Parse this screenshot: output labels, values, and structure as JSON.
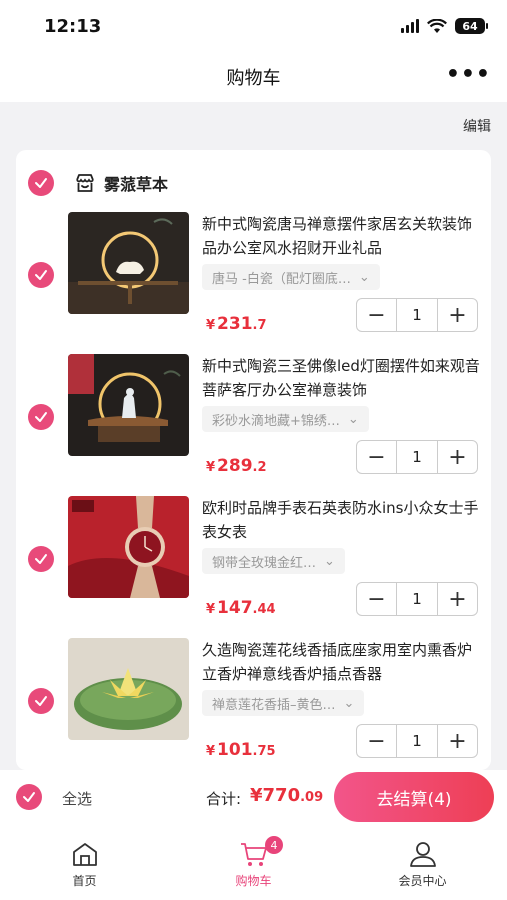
{
  "status_bar": {
    "time": "12:13",
    "battery": "64"
  },
  "header": {
    "title": "购物车",
    "more": "•••"
  },
  "edit_label": "编辑",
  "shop": {
    "name": "雾蒎草本",
    "checked": true
  },
  "items": [
    {
      "title": "新中式陶瓷唐马禅意摆件家居玄关软装饰品办公室风水招财开业礼品",
      "spec": "唐马 -白瓷（配灯圈底…",
      "price_int": "231",
      "price_dec": ".7",
      "quantity": "1",
      "checked": true
    },
    {
      "title": "新中式陶瓷三圣佛像led灯圈摆件如来观音菩萨客厅办公室禅意装饰",
      "spec": "彩砂水滴地藏+锦绣…",
      "price_int": "289",
      "price_dec": ".2",
      "quantity": "1",
      "checked": true
    },
    {
      "title": "欧利时品牌手表石英表防水ins小众女士手表女表",
      "spec": "钢带全玫瑰金红…",
      "price_int": "147",
      "price_dec": ".44",
      "quantity": "1",
      "checked": true
    },
    {
      "title": "久造陶瓷莲花线香插底座家用室内熏香炉立香炉禅意线香炉插点香器",
      "spec": "禅意莲花香插–黄色…",
      "price_int": "101",
      "price_dec": ".75",
      "quantity": "1",
      "checked": true
    }
  ],
  "currency": "¥",
  "footer": {
    "select_all": "全选",
    "total_label": "合计:",
    "total_int": "770",
    "total_dec": ".09",
    "checkout": "去结算(4)"
  },
  "tabs": [
    {
      "label": "首页",
      "icon": "home-icon"
    },
    {
      "label": "购物车",
      "icon": "cart-icon",
      "badge": "4",
      "active": true
    },
    {
      "label": "会员中心",
      "icon": "member-icon"
    }
  ],
  "colors": {
    "accent": "#e84a7a",
    "price": "#e8303c"
  }
}
